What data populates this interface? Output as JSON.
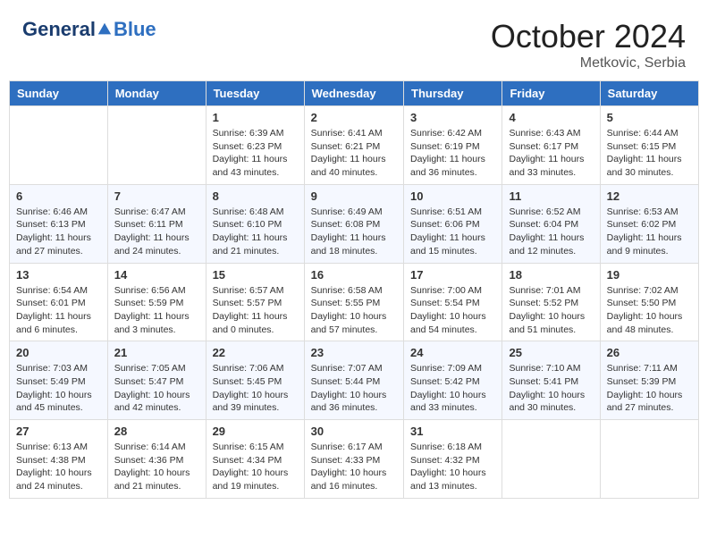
{
  "header": {
    "logo_general": "General",
    "logo_blue": "Blue",
    "month": "October 2024",
    "location": "Metkovic, Serbia"
  },
  "days_of_week": [
    "Sunday",
    "Monday",
    "Tuesday",
    "Wednesday",
    "Thursday",
    "Friday",
    "Saturday"
  ],
  "weeks": [
    [
      {
        "day": "",
        "content": ""
      },
      {
        "day": "",
        "content": ""
      },
      {
        "day": "1",
        "content": "Sunrise: 6:39 AM\nSunset: 6:23 PM\nDaylight: 11 hours and 43 minutes."
      },
      {
        "day": "2",
        "content": "Sunrise: 6:41 AM\nSunset: 6:21 PM\nDaylight: 11 hours and 40 minutes."
      },
      {
        "day": "3",
        "content": "Sunrise: 6:42 AM\nSunset: 6:19 PM\nDaylight: 11 hours and 36 minutes."
      },
      {
        "day": "4",
        "content": "Sunrise: 6:43 AM\nSunset: 6:17 PM\nDaylight: 11 hours and 33 minutes."
      },
      {
        "day": "5",
        "content": "Sunrise: 6:44 AM\nSunset: 6:15 PM\nDaylight: 11 hours and 30 minutes."
      }
    ],
    [
      {
        "day": "6",
        "content": "Sunrise: 6:46 AM\nSunset: 6:13 PM\nDaylight: 11 hours and 27 minutes."
      },
      {
        "day": "7",
        "content": "Sunrise: 6:47 AM\nSunset: 6:11 PM\nDaylight: 11 hours and 24 minutes."
      },
      {
        "day": "8",
        "content": "Sunrise: 6:48 AM\nSunset: 6:10 PM\nDaylight: 11 hours and 21 minutes."
      },
      {
        "day": "9",
        "content": "Sunrise: 6:49 AM\nSunset: 6:08 PM\nDaylight: 11 hours and 18 minutes."
      },
      {
        "day": "10",
        "content": "Sunrise: 6:51 AM\nSunset: 6:06 PM\nDaylight: 11 hours and 15 minutes."
      },
      {
        "day": "11",
        "content": "Sunrise: 6:52 AM\nSunset: 6:04 PM\nDaylight: 11 hours and 12 minutes."
      },
      {
        "day": "12",
        "content": "Sunrise: 6:53 AM\nSunset: 6:02 PM\nDaylight: 11 hours and 9 minutes."
      }
    ],
    [
      {
        "day": "13",
        "content": "Sunrise: 6:54 AM\nSunset: 6:01 PM\nDaylight: 11 hours and 6 minutes."
      },
      {
        "day": "14",
        "content": "Sunrise: 6:56 AM\nSunset: 5:59 PM\nDaylight: 11 hours and 3 minutes."
      },
      {
        "day": "15",
        "content": "Sunrise: 6:57 AM\nSunset: 5:57 PM\nDaylight: 11 hours and 0 minutes."
      },
      {
        "day": "16",
        "content": "Sunrise: 6:58 AM\nSunset: 5:55 PM\nDaylight: 10 hours and 57 minutes."
      },
      {
        "day": "17",
        "content": "Sunrise: 7:00 AM\nSunset: 5:54 PM\nDaylight: 10 hours and 54 minutes."
      },
      {
        "day": "18",
        "content": "Sunrise: 7:01 AM\nSunset: 5:52 PM\nDaylight: 10 hours and 51 minutes."
      },
      {
        "day": "19",
        "content": "Sunrise: 7:02 AM\nSunset: 5:50 PM\nDaylight: 10 hours and 48 minutes."
      }
    ],
    [
      {
        "day": "20",
        "content": "Sunrise: 7:03 AM\nSunset: 5:49 PM\nDaylight: 10 hours and 45 minutes."
      },
      {
        "day": "21",
        "content": "Sunrise: 7:05 AM\nSunset: 5:47 PM\nDaylight: 10 hours and 42 minutes."
      },
      {
        "day": "22",
        "content": "Sunrise: 7:06 AM\nSunset: 5:45 PM\nDaylight: 10 hours and 39 minutes."
      },
      {
        "day": "23",
        "content": "Sunrise: 7:07 AM\nSunset: 5:44 PM\nDaylight: 10 hours and 36 minutes."
      },
      {
        "day": "24",
        "content": "Sunrise: 7:09 AM\nSunset: 5:42 PM\nDaylight: 10 hours and 33 minutes."
      },
      {
        "day": "25",
        "content": "Sunrise: 7:10 AM\nSunset: 5:41 PM\nDaylight: 10 hours and 30 minutes."
      },
      {
        "day": "26",
        "content": "Sunrise: 7:11 AM\nSunset: 5:39 PM\nDaylight: 10 hours and 27 minutes."
      }
    ],
    [
      {
        "day": "27",
        "content": "Sunrise: 6:13 AM\nSunset: 4:38 PM\nDaylight: 10 hours and 24 minutes."
      },
      {
        "day": "28",
        "content": "Sunrise: 6:14 AM\nSunset: 4:36 PM\nDaylight: 10 hours and 21 minutes."
      },
      {
        "day": "29",
        "content": "Sunrise: 6:15 AM\nSunset: 4:34 PM\nDaylight: 10 hours and 19 minutes."
      },
      {
        "day": "30",
        "content": "Sunrise: 6:17 AM\nSunset: 4:33 PM\nDaylight: 10 hours and 16 minutes."
      },
      {
        "day": "31",
        "content": "Sunrise: 6:18 AM\nSunset: 4:32 PM\nDaylight: 10 hours and 13 minutes."
      },
      {
        "day": "",
        "content": ""
      },
      {
        "day": "",
        "content": ""
      }
    ]
  ]
}
